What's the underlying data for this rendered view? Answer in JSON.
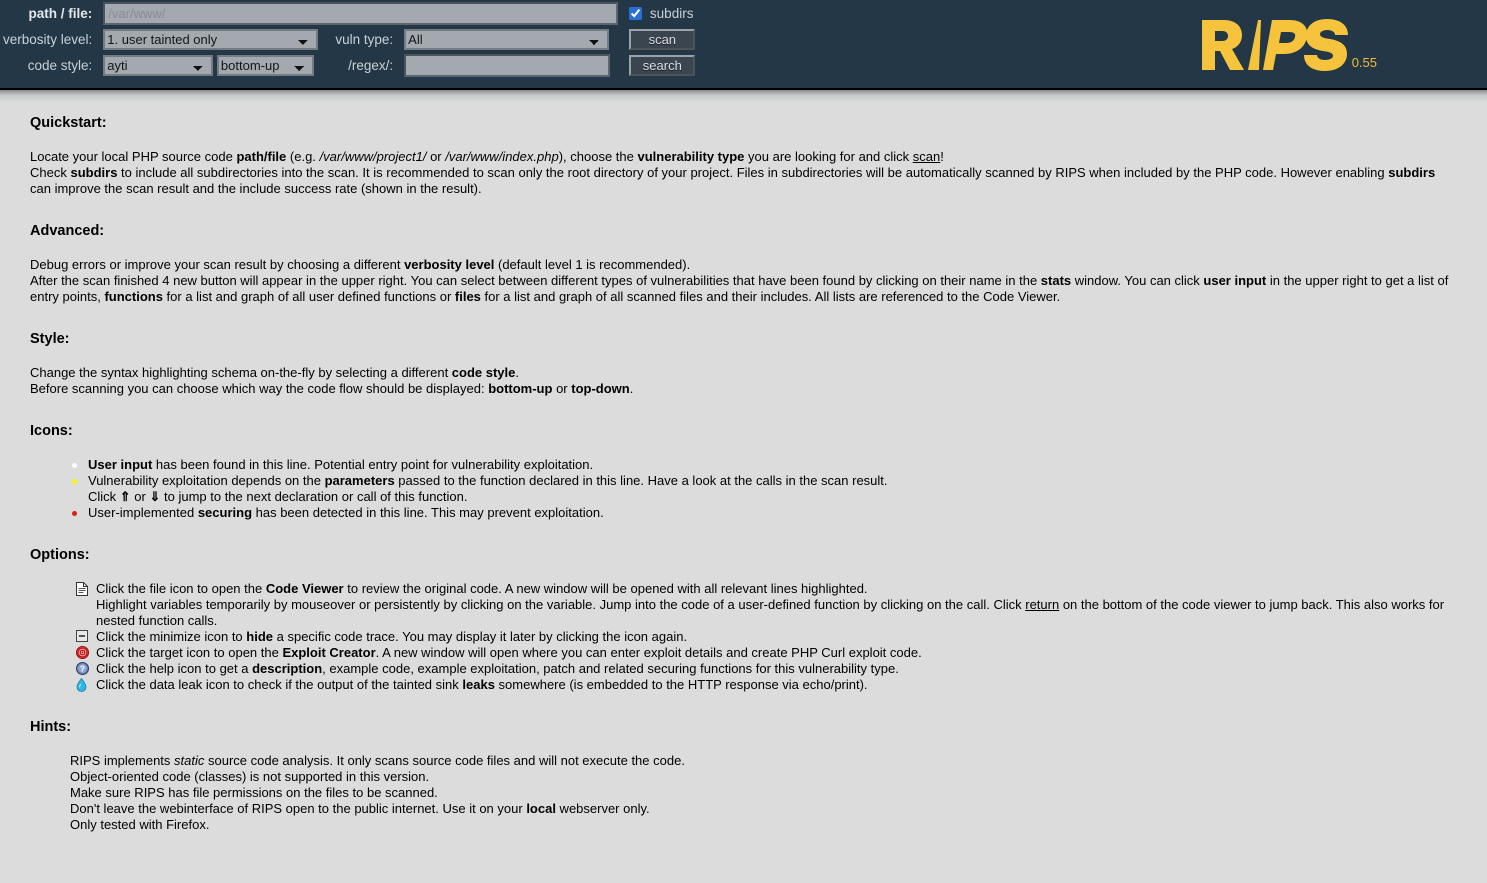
{
  "header": {
    "labels": {
      "path": "path / file:",
      "verbosity": "verbosity level:",
      "code_style": "code style:",
      "vuln_type": "vuln type:",
      "regex": "/regex/:",
      "subdirs": "subdirs"
    },
    "path_value": "",
    "path_placeholder": "/var/www/",
    "regex_value": "",
    "regex_placeholder": "",
    "subdirs_checked": true,
    "verbosity_selected": "1. user tainted only",
    "vuln_selected": "All",
    "code_style_selected": "ayti",
    "code_flow_selected": "bottom-up",
    "scan_button": "scan",
    "search_button": "search",
    "logo_text": "RIPS",
    "logo_version": "0.55",
    "logo_color": "#f5c43c",
    "bar_color": "#243747"
  },
  "sections": {
    "quickstart": {
      "title": "Quickstart:",
      "line1_a": "Locate your local PHP source code ",
      "line1_b": "path/file",
      "line1_c": " (e.g. ",
      "line1_d": "/var/www/project1/",
      "line1_e": " or ",
      "line1_f": "/var/www/index.php",
      "line1_g": "), choose the ",
      "line1_h": "vulnerability type",
      "line1_i": " you are looking for and click ",
      "line1_j": "scan",
      "line1_k": "!",
      "line2_a": "Check ",
      "line2_b": "subdirs",
      "line2_c": " to include all subdirectories into the scan. It is recommended to scan only the root directory of your project. Files in subdirectories will be automatically scanned by RIPS when included by the PHP code. However enabling ",
      "line2_d": "subdirs",
      "line2_e": " can improve the scan result and the include success rate (shown in the result)."
    },
    "advanced": {
      "title": "Advanced:",
      "line1_a": "Debug errors or improve your scan result by choosing a different ",
      "line1_b": "verbosity level",
      "line1_c": " (default level 1 is recommended).",
      "line2_a": "After the scan finished 4 new button will appear in the upper right. You can select between different types of vulnerabilities that have been found by clicking on their name in the ",
      "line2_b": "stats",
      "line2_c": " window. You can click ",
      "line2_d": "user input",
      "line2_e": " in the upper right to get a list of entry points, ",
      "line2_f": "functions",
      "line2_g": " for a list and graph of all user defined functions or ",
      "line2_h": "files",
      "line2_i": " for a list and graph of all scanned files and their includes. All lists are referenced to the Code Viewer."
    },
    "style": {
      "title": "Style:",
      "line1_a": "Change the syntax highlighting schema on-the-fly by selecting a different ",
      "line1_b": "code style",
      "line1_c": ".",
      "line2_a": "Before scanning you can choose which way the code flow should be displayed: ",
      "line2_b": "bottom-up",
      "line2_c": " or ",
      "line2_d": "top-down",
      "line2_e": "."
    },
    "icons": {
      "title": "Icons:",
      "items": [
        {
          "bullet": "white",
          "a": "User input",
          "b": " has been found in this line. Potential entry point for vulnerability exploitation."
        },
        {
          "bullet": "yellow",
          "a": "Vulnerability exploitation depends on the ",
          "b": "parameters",
          "c": " passed to the function declared in this line. Have a look at the calls in the scan result.",
          "d": "Click ",
          "e": "⇑",
          "f": " or ",
          "g": "⇓",
          "h": " to jump to the next declaration or call of this function."
        },
        {
          "bullet": "red",
          "a": "User-implemented ",
          "b": "securing",
          "c": " has been detected in this line. This may prevent exploitation."
        }
      ]
    },
    "options": {
      "title": "Options:",
      "items": [
        {
          "icon": "file-icon",
          "a": "Click the file icon to open the ",
          "b": "Code Viewer",
          "c": " to review the original code. A new window will be opened with all relevant lines highlighted."
        },
        {
          "icon": "none",
          "a": "Highlight variables temporarily by mouseover or persistently by clicking on the variable. Jump into the code of a user-defined function by clicking on the call. Click ",
          "b": "return",
          "c": " on the bottom of the code viewer to jump back. This also works for nested function calls."
        },
        {
          "icon": "minimize-icon",
          "a": "Click the minimize icon to ",
          "b": "hide",
          "c": " a specific code trace. You may display it later by clicking the icon again."
        },
        {
          "icon": "target-icon",
          "a": "Click the target icon to open the ",
          "b": "Exploit Creator",
          "c": ". A new window will open where you can enter exploit details and create PHP Curl exploit code."
        },
        {
          "icon": "help-icon",
          "a": "Click the help icon to get a ",
          "b": "description",
          "c": ", example code, example exploitation, patch and related securing functions for this vulnerability type."
        },
        {
          "icon": "dataleak-icon",
          "a": "Click the data leak icon to check if the output of the tainted sink ",
          "b": "leaks",
          "c": " somewhere (is embedded to the HTTP response via echo/print)."
        }
      ]
    },
    "hints": {
      "title": "Hints:",
      "line1_a": "RIPS implements ",
      "line1_b": "static",
      "line1_c": " source code analysis. It only scans source code files and will not execute the code.",
      "line2": "Object-oriented code (classes) is not supported in this version.",
      "line3": "Make sure RIPS has file permissions on the files to be scanned.",
      "line4_a": "Don't leave the webinterface of RIPS open to the public internet. Use it on your ",
      "line4_b": "local",
      "line4_c": " webserver only.",
      "line5": "Only tested with Firefox."
    }
  }
}
